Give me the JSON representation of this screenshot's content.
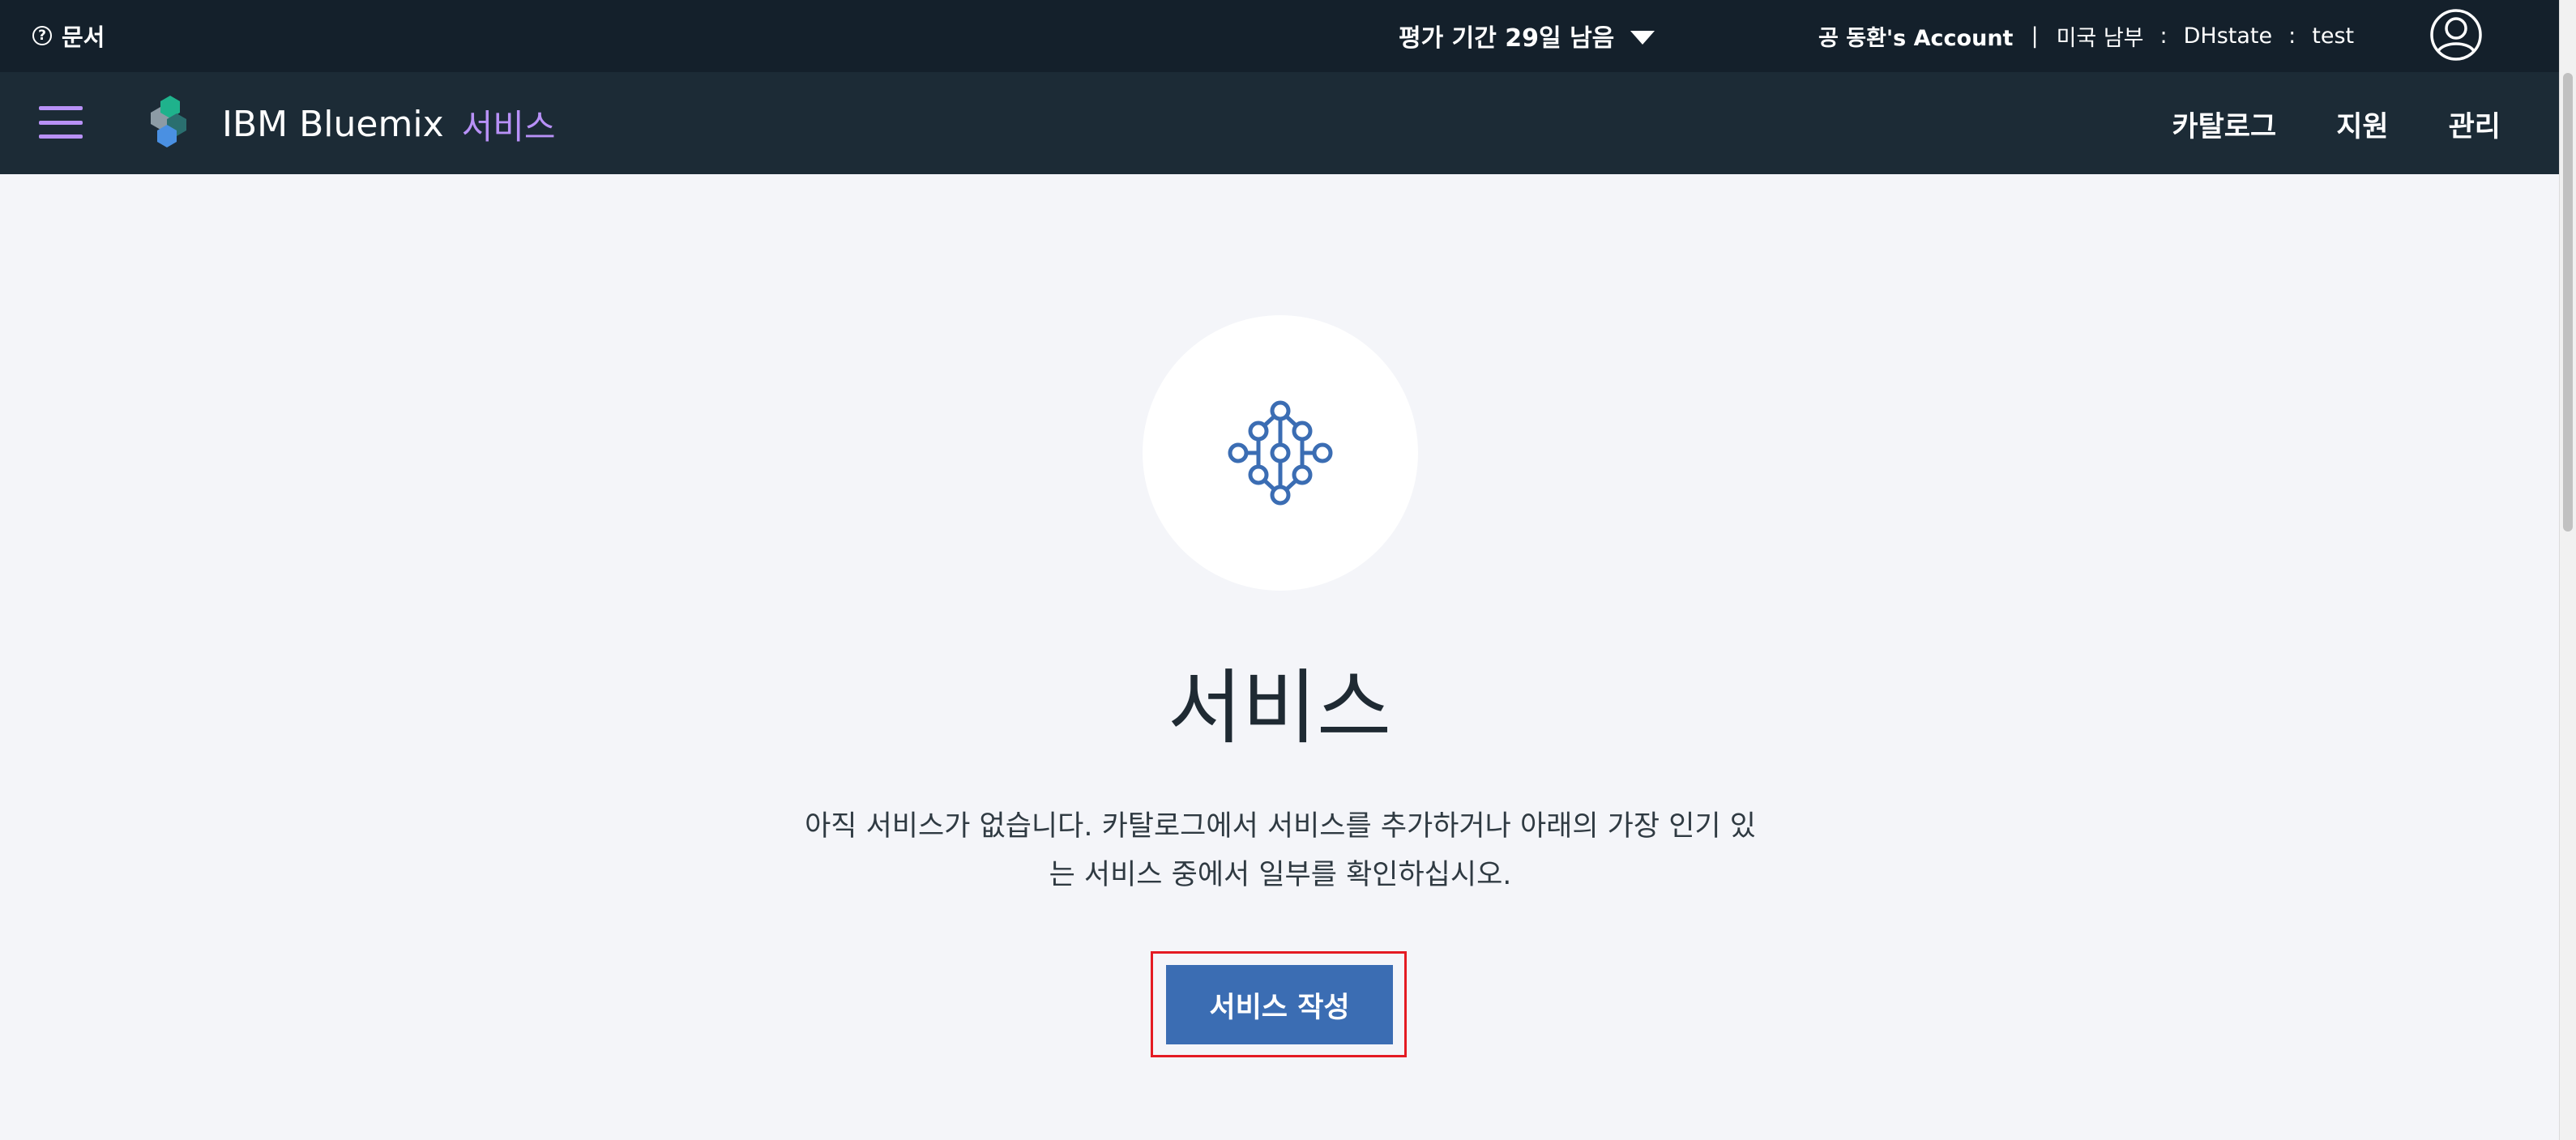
{
  "topbar": {
    "docs_label": "문서",
    "trial_label": "평가 기간 29일 남음",
    "account_name": "공 동환's Account",
    "separator": "|",
    "region": "미국 남부",
    "colon": ":",
    "org": "DHstate",
    "space": "test"
  },
  "navbar": {
    "brand": "IBM Bluemix",
    "section": "서비스",
    "links": [
      "카탈로그",
      "지원",
      "관리"
    ]
  },
  "main": {
    "title": "서비스",
    "description_line1": "아직 서비스가 없습니다. 카탈로그에서 서비스를 추가하거나 아래의 가장 인기 있",
    "description_line2": "는 서비스 중에서 일부를 확인하십시오.",
    "create_button": "서비스 작성"
  },
  "icons": {
    "help": "help-icon",
    "dropdown": "chevron-down-icon",
    "avatar": "user-avatar-icon",
    "menu": "hamburger-menu-icon",
    "logo": "bluemix-logo-icon",
    "services": "service-network-icon"
  },
  "colors": {
    "topbar_bg": "#14202b",
    "navbar_bg": "#1c2b36",
    "accent_purple": "#b891f7",
    "button_blue": "#3b6db3",
    "page_bg": "#f4f5f9",
    "highlight_red": "#e41b23"
  }
}
